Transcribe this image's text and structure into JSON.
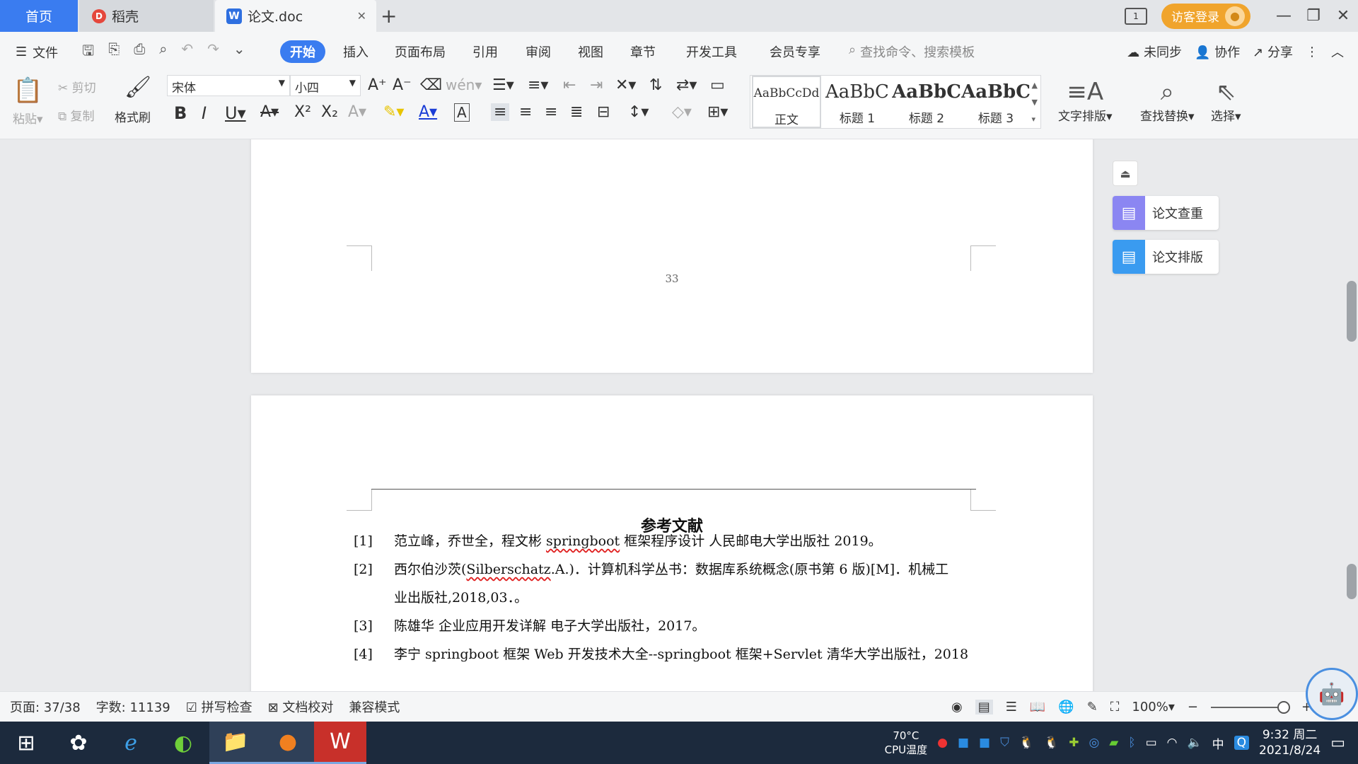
{
  "tabs": {
    "home": "首页",
    "daoke": "稻壳",
    "doc": "论文.doc",
    "login": "访客登录"
  },
  "menu": {
    "file": "文件",
    "items": [
      "开始",
      "插入",
      "页面布局",
      "引用",
      "审阅",
      "视图",
      "章节",
      "开发工具",
      "会员专享"
    ],
    "search_placeholder": "查找命令、搜索模板",
    "sync": "未同步",
    "collab": "协作",
    "share": "分享"
  },
  "ribbon": {
    "paste": "粘贴",
    "cut": "剪切",
    "copy": "复制",
    "format_painter": "格式刷",
    "font_name": "宋体",
    "font_size": "小四",
    "styles": [
      {
        "preview": "AaBbCcDd",
        "name": "正文"
      },
      {
        "preview": "AaBbC",
        "name": "标题 1"
      },
      {
        "preview": "AaBbC",
        "name": "标题 2"
      },
      {
        "preview": "AaBbC",
        "name": "标题 3"
      }
    ],
    "text_layout": "文字排版",
    "find_replace": "查找替换",
    "select": "选择"
  },
  "side_panel": {
    "check": "论文查重",
    "format": "论文排版"
  },
  "document": {
    "page_number": "33",
    "ref_title": "参考文献",
    "refs": [
      {
        "num": "[1]",
        "text": "范立峰，乔世全，程文彬 ",
        "sq": "springboot",
        "rest": " 框架程序设计  人民邮电大学出版社 2019。"
      },
      {
        "num": "[2]",
        "text": "西尔伯沙茨(",
        "sq": "Silberschatz",
        "rest": ".A.)．计算机科学丛书：数据库系统概念(原书第 6 版)[M]．机械工",
        "cont": "业出版社,2018,03．。"
      },
      {
        "num": "[3]",
        "text": "陈雄华  企业应用开发详解  电子大学出版社，2017。",
        "sq": "",
        "rest": ""
      },
      {
        "num": "[4]",
        "text": "李宁 springboot 框架  Web 开发技术大全--springboot 框架+Servlet 清华大学出版社，2018",
        "sq": "",
        "rest": ""
      }
    ]
  },
  "status": {
    "page": "页面: 37/38",
    "words": "字数: 11139",
    "spell": "拼写检查",
    "proof": "文档校对",
    "compat": "兼容模式",
    "zoom": "100%"
  },
  "taskbar": {
    "temp": "70°C",
    "temp_label": "CPU温度",
    "ime": "中",
    "time": "9:32 周二",
    "date": "2021/8/24"
  }
}
